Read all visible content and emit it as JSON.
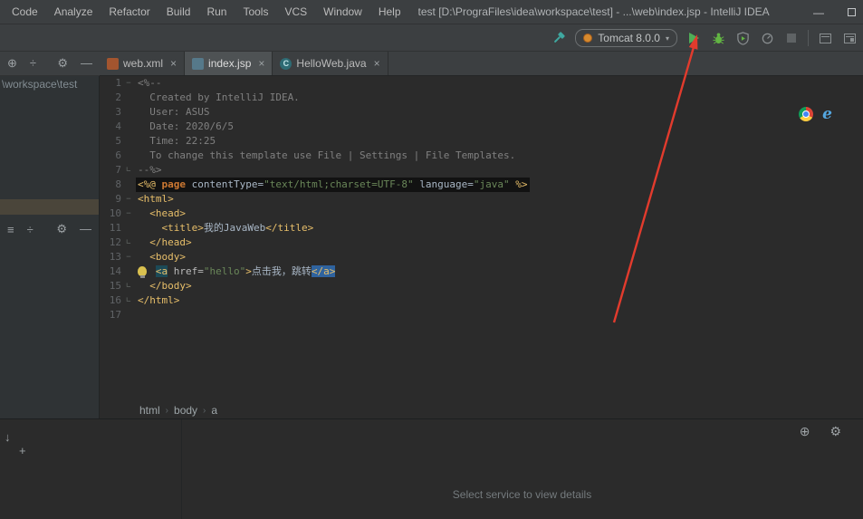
{
  "window": {
    "title": "test [D:\\PrograFiles\\idea\\workspace\\test] - ...\\web\\index.jsp - IntelliJ IDEA"
  },
  "menu": [
    "Code",
    "Analyze",
    "Refactor",
    "Build",
    "Run",
    "Tools",
    "VCS",
    "Window",
    "Help"
  ],
  "toolbar": {
    "run_config": "Tomcat 8.0.0"
  },
  "icons": {
    "minimize": "—",
    "close": "×",
    "dropdown": "▾",
    "target": "⊕",
    "collapse": "÷",
    "gear": "⚙",
    "hide": "—",
    "rows": "≡",
    "plus": "+",
    "down_arrow": "↓",
    "crumb_sep": "›",
    "class_letter": "C",
    "ie_letter": "e"
  },
  "tabs": [
    {
      "label": "web.xml",
      "icon": "xml-file",
      "active": false
    },
    {
      "label": "index.jsp",
      "icon": "jsp-file",
      "active": true
    },
    {
      "label": "HelloWeb.java",
      "icon": "java-class",
      "active": false
    }
  ],
  "project": {
    "root_text": "\\workspace\\test"
  },
  "editor": {
    "breadcrumbs": [
      "html",
      "body",
      "a"
    ],
    "lines": [
      {
        "n": 1,
        "fold": "-",
        "tokens": [
          {
            "t": "<%--",
            "c": "cmt"
          }
        ]
      },
      {
        "n": 2,
        "tokens": [
          {
            "t": "  Created by IntelliJ IDEA.",
            "c": "cmt"
          }
        ]
      },
      {
        "n": 3,
        "tokens": [
          {
            "t": "  User: ASUS",
            "c": "cmt"
          }
        ]
      },
      {
        "n": 4,
        "tokens": [
          {
            "t": "  Date: 2020/6/5",
            "c": "cmt"
          }
        ]
      },
      {
        "n": 5,
        "tokens": [
          {
            "t": "  Time: 22:25",
            "c": "cmt"
          }
        ]
      },
      {
        "n": 6,
        "tokens": [
          {
            "t": "  To change this template use File | Settings | File Templates.",
            "c": "cmt"
          }
        ]
      },
      {
        "n": 7,
        "fold": "e",
        "tokens": [
          {
            "t": "--%>",
            "c": "cmt"
          }
        ]
      },
      {
        "n": 8,
        "bg": "dir",
        "tokens": [
          {
            "t": "<%@ ",
            "c": "tag"
          },
          {
            "t": "page",
            "c": "kw"
          },
          {
            "t": " contentType=",
            "c": "plain"
          },
          {
            "t": "\"text/html;charset=UTF-8\"",
            "c": "str"
          },
          {
            "t": " language=",
            "c": "plain"
          },
          {
            "t": "\"java\"",
            "c": "str"
          },
          {
            "t": " %>",
            "c": "tag"
          }
        ]
      },
      {
        "n": 9,
        "fold": "-",
        "tokens": [
          {
            "t": "<html>",
            "c": "tag"
          }
        ]
      },
      {
        "n": 10,
        "fold": "-",
        "tokens": [
          {
            "t": "  ",
            "c": "plain"
          },
          {
            "t": "<head>",
            "c": "tag"
          }
        ]
      },
      {
        "n": 11,
        "tokens": [
          {
            "t": "    ",
            "c": "plain"
          },
          {
            "t": "<title>",
            "c": "tag"
          },
          {
            "t": "我的JavaWeb",
            "c": "plain"
          },
          {
            "t": "</title>",
            "c": "tag"
          }
        ]
      },
      {
        "n": 12,
        "fold": "e",
        "tokens": [
          {
            "t": "  ",
            "c": "plain"
          },
          {
            "t": "</head>",
            "c": "tag"
          }
        ]
      },
      {
        "n": 13,
        "fold": "-",
        "tokens": [
          {
            "t": "  ",
            "c": "plain"
          },
          {
            "t": "<body>",
            "c": "tag"
          }
        ]
      },
      {
        "n": 14,
        "bulb": true,
        "tokens": [
          {
            "t": "   ",
            "c": "plain"
          },
          {
            "t": "<a",
            "c": "tag hl-open"
          },
          {
            "t": " href=",
            "c": "attr"
          },
          {
            "t": "\"hello\"",
            "c": "str"
          },
          {
            "t": ">",
            "c": "tag"
          },
          {
            "t": "点击我，跳转",
            "c": "plain"
          },
          {
            "t": "</a>",
            "c": "tag hl-close"
          }
        ]
      },
      {
        "n": 15,
        "fold": "e",
        "tokens": [
          {
            "t": "  ",
            "c": "plain"
          },
          {
            "t": "</body>",
            "c": "tag"
          }
        ]
      },
      {
        "n": 16,
        "fold": "e",
        "tokens": [
          {
            "t": "</html>",
            "c": "tag"
          }
        ]
      },
      {
        "n": 17,
        "tokens": []
      }
    ]
  },
  "bottom": {
    "hint": "Select service to view details"
  }
}
